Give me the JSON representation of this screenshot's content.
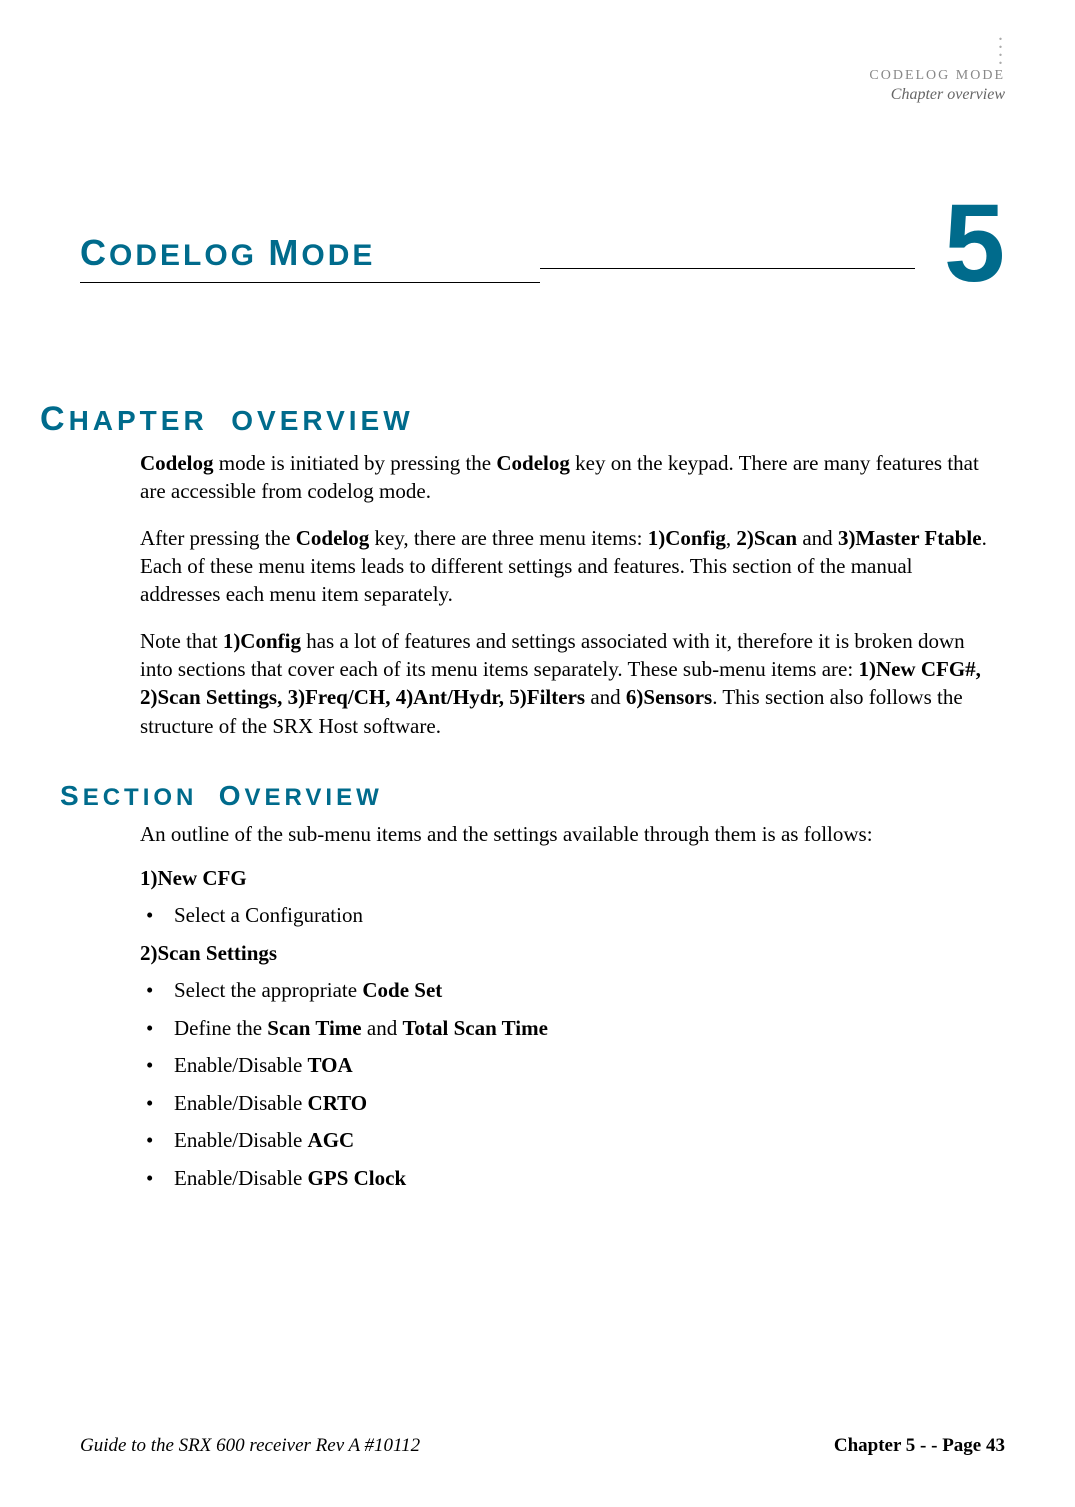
{
  "header": {
    "mode_label": "CODELOG MODE",
    "subtitle": "Chapter overview"
  },
  "chapter_number": "5",
  "page_title": {
    "word1_first": "C",
    "word1_rest": "ODELOG",
    "word2_first": "M",
    "word2_rest": "ODE"
  },
  "section1": {
    "heading_first1": "C",
    "heading_rest1": "HAPTER",
    "heading_rest2": "OVERVIEW",
    "para1_a": "Codelog",
    "para1_b": " mode is initiated by pressing the ",
    "para1_c": "Codelog",
    "para1_d": " key on the keypad. There are many features that are accessible from codelog mode.",
    "para2_a": "After pressing the ",
    "para2_b": "Codelog",
    "para2_c": " key, there are three menu items: ",
    "para2_d": "1)Config",
    "para2_e": ", ",
    "para2_f": "2)Scan",
    "para2_g": " and ",
    "para2_h": "3)Master Ftable",
    "para2_i": ". Each of these menu items leads to different settings and features. This section of the manual addresses each menu item separately.",
    "para3_a": "Note that ",
    "para3_b": "1)Config",
    "para3_c": " has a lot of features and settings associated with it, therefore it is broken down into sections that cover each of its menu items separately. These sub-menu items are: ",
    "para3_d": "1)New CFG#, 2)Scan Settings, 3)Freq/CH, 4)Ant/Hydr, 5)Filters",
    "para3_e": " and ",
    "para3_f": "6)Sensors",
    "para3_g": ". This section also follows the structure of the SRX Host software."
  },
  "section2": {
    "heading_first1": "S",
    "heading_rest1": "ECTION",
    "heading_first2": "O",
    "heading_rest2": "VERVIEW",
    "intro": "An outline of the sub-menu items and the settings available through them is as follows:",
    "group1_heading": "1)New CFG",
    "group1_items": [
      {
        "plain": "Select a Configuration"
      }
    ],
    "group2_heading": "2)Scan Settings",
    "group2_items": [
      {
        "a": "Select the appropriate ",
        "b": "Code Set"
      },
      {
        "a": "Define the ",
        "b": "Scan Time",
        "c": " and ",
        "d": "Total Scan Time"
      },
      {
        "a": "Enable/Disable ",
        "b": "TOA"
      },
      {
        "a": "Enable/Disable ",
        "b": "CRTO"
      },
      {
        "a": "Enable/Disable ",
        "b": "AGC"
      },
      {
        "a": "Enable/Disable ",
        "b": "GPS Clock"
      }
    ]
  },
  "footer": {
    "left": "Guide to the SRX 600 receiver Rev A #10112",
    "right": "Chapter 5 - - Page 43"
  }
}
